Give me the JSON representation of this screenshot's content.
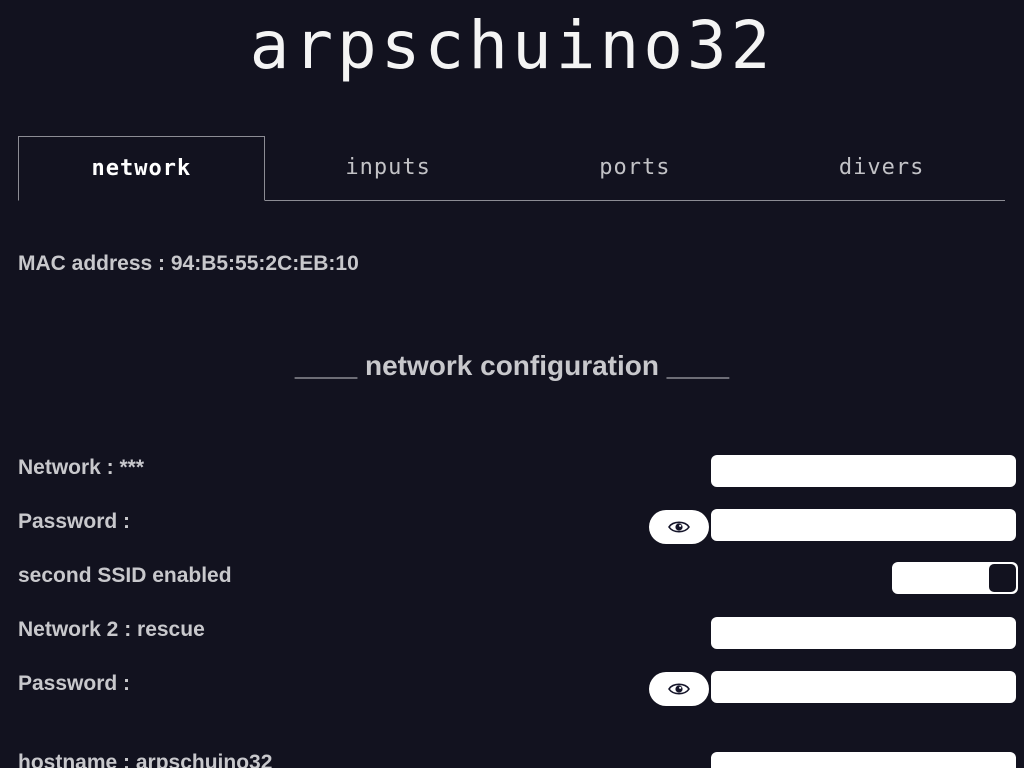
{
  "app": {
    "title": "arpschuino32"
  },
  "tabs": [
    {
      "label": "network",
      "active": true
    },
    {
      "label": "inputs",
      "active": false
    },
    {
      "label": "ports",
      "active": false
    },
    {
      "label": "divers",
      "active": false
    }
  ],
  "mac": {
    "label": "MAC address : 94:B5:55:2C:EB:10"
  },
  "section": {
    "heading": "____ network configuration ____"
  },
  "network": {
    "ssid_label": "Network : ***",
    "ssid_value": "",
    "password_label": "Password :",
    "password_value": "",
    "second_ssid_label": "second SSID enabled",
    "second_ssid_enabled": true,
    "ssid2_label": "Network 2 : rescue",
    "ssid2_value": "",
    "password2_label": "Password :",
    "password2_value": "",
    "hostname_label": "hostname : arpschuino32",
    "hostname_value": ""
  },
  "icons": {
    "password_toggle": "eye-icon",
    "password2_toggle": "eye-icon"
  },
  "colors": {
    "background": "#12121f",
    "text": "#c8c8cc",
    "title": "#f4f4f4",
    "field": "#ffffff",
    "border": "#8c8c94"
  }
}
